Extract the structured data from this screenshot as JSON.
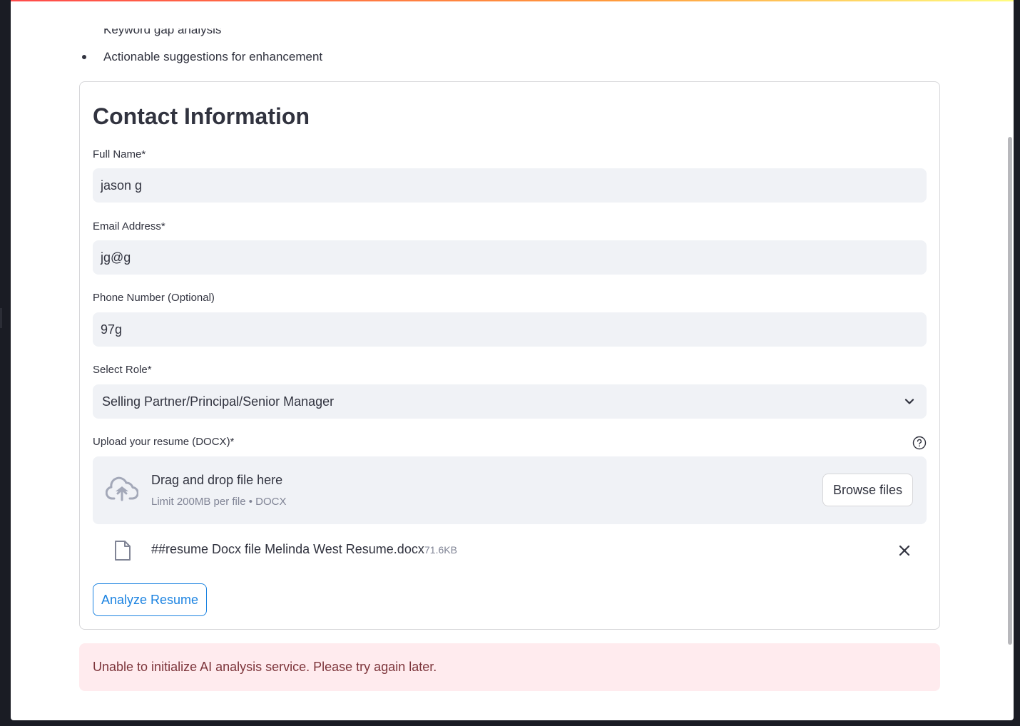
{
  "page": {
    "cut_off_text": "Keyword gap analysis",
    "bullets": [
      "Actionable suggestions for enhancement"
    ]
  },
  "form": {
    "title": "Contact Information",
    "full_name": {
      "label": "Full Name*",
      "value": "jason g"
    },
    "email": {
      "label": "Email Address*",
      "value": "jg@g"
    },
    "phone": {
      "label": "Phone Number (Optional)",
      "value": "97g"
    },
    "role": {
      "label": "Select Role*",
      "selected": "Selling Partner/Principal/Senior Manager"
    },
    "upload": {
      "label": "Upload your resume (DOCX)*",
      "drop_title": "Drag and drop file here",
      "drop_subtitle": "Limit 200MB per file • DOCX",
      "browse_label": "Browse files",
      "file_name": "##resume Docx file Melinda West Resume.docx",
      "file_size": "71.6KB"
    },
    "submit_label": "Analyze Resume"
  },
  "alert": {
    "message": "Unable to initialize AI analysis service. Please try again later."
  },
  "icons": {
    "help": "help-icon",
    "upload": "cloud-upload-icon",
    "file": "file-icon",
    "remove": "close-icon",
    "dropdown": "chevron-down-icon"
  },
  "colors": {
    "accent": "#1c83e1",
    "input_bg": "#f0f2f6",
    "error_bg": "#ffebee",
    "error_text": "#7d353b",
    "text": "#31333f"
  }
}
